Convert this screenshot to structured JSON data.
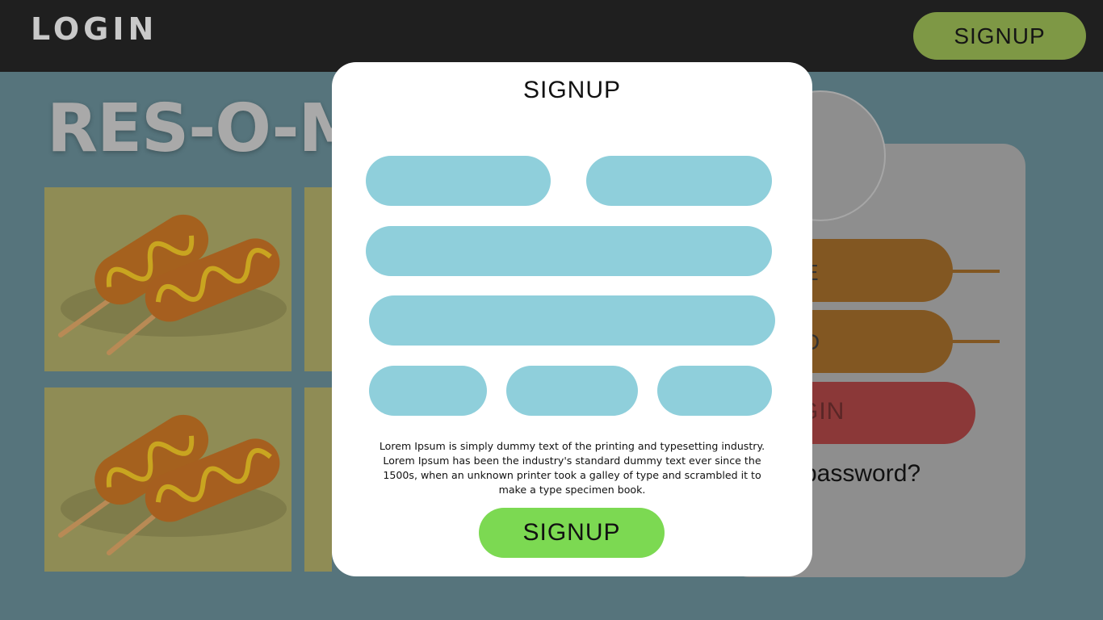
{
  "header": {
    "login_label": "LOGIN",
    "signup_button": "SIGNUP"
  },
  "background_page": {
    "brand_title": "RES-O-M",
    "login_card": {
      "field1_fragment": "E",
      "field2_fragment": "D",
      "login_fragment": "GIN",
      "forgot_fragment": "password?"
    },
    "food_image_icon": "corn-dog-icon"
  },
  "modal": {
    "title": "SIGNUP",
    "description": "Lorem Ipsum is simply dummy text of the printing and typesetting industry. Lorem Ipsum has been the industry's standard dummy text ever since the 1500s, when an unknown printer took a galley of type and scrambled it to make a type specimen book.",
    "signup_button": "SIGNUP"
  },
  "colors": {
    "header_bg": "#1f1f1f",
    "header_button": "#7e9845",
    "page_bg": "#56747c",
    "field_bg": "#8fcfdb",
    "modal_button": "#7cd952",
    "login_button_dim": "#8b3838"
  }
}
